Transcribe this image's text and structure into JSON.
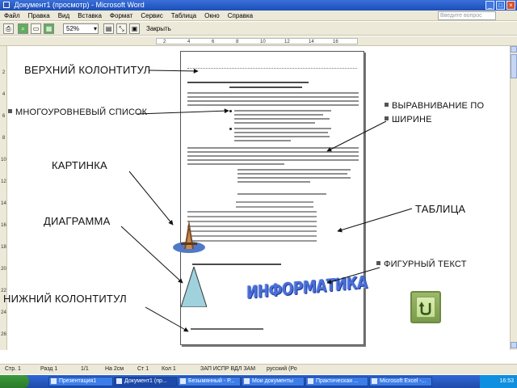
{
  "window": {
    "title": "Документ1 (просмотр) - Microsoft Word"
  },
  "menu": {
    "items": [
      "Файл",
      "Правка",
      "Вид",
      "Вставка",
      "Формат",
      "Сервис",
      "Таблица",
      "Окно",
      "Справка"
    ],
    "help_placeholder": "Введите вопрос"
  },
  "toolbar": {
    "zoom": "52%",
    "close_label": "Закрыть"
  },
  "ruler": {
    "ticks": [
      "2",
      "4",
      "6",
      "8",
      "10",
      "12",
      "14",
      "16"
    ]
  },
  "vruler": {
    "ticks": [
      "2",
      "4",
      "6",
      "8",
      "10",
      "12",
      "14",
      "16",
      "18",
      "20",
      "22",
      "24",
      "26"
    ]
  },
  "callouts": {
    "header": "ВЕРХНИЙ КОЛОНТИТУЛ",
    "multilevel_list": "МНОГОУРОВНЕВЫЙ СПИСОК",
    "justify_line1": "ВЫРАВНИВАНИЕ ПО",
    "justify_line2": "ШИРИНЕ",
    "picture": "КАРТИНКА",
    "table": "ТАБЛИЦА",
    "diagram": "ДИАГРАММА",
    "wordart": "ФИГУРНЫЙ ТЕКСТ",
    "footer": "НИЖНИЙ КОЛОНТИТУЛ"
  },
  "wordart_text": "ИНФОРМАТИКА",
  "statusbar": {
    "page": "Стр. 1",
    "section": "Разд 1",
    "pages": "1/1",
    "position": "На 2см",
    "line": "Ст 1",
    "column": "Кол 1",
    "modes": "ЗАП  ИСПР  ВДЛ  ЗАМ",
    "lang": "русский (Ро"
  },
  "taskbar": {
    "items": [
      "Презентация1",
      "Документ1 (пр...",
      "Безымянный - Р...",
      "Мои документы",
      "Практическая ...",
      "Microsoft Excel -..."
    ],
    "active_index": 1,
    "clock": "16:53"
  },
  "colors": {
    "wordart": "#4a6fd6",
    "triangle": "#9fd2dc",
    "back_button": "#9cb86a"
  }
}
